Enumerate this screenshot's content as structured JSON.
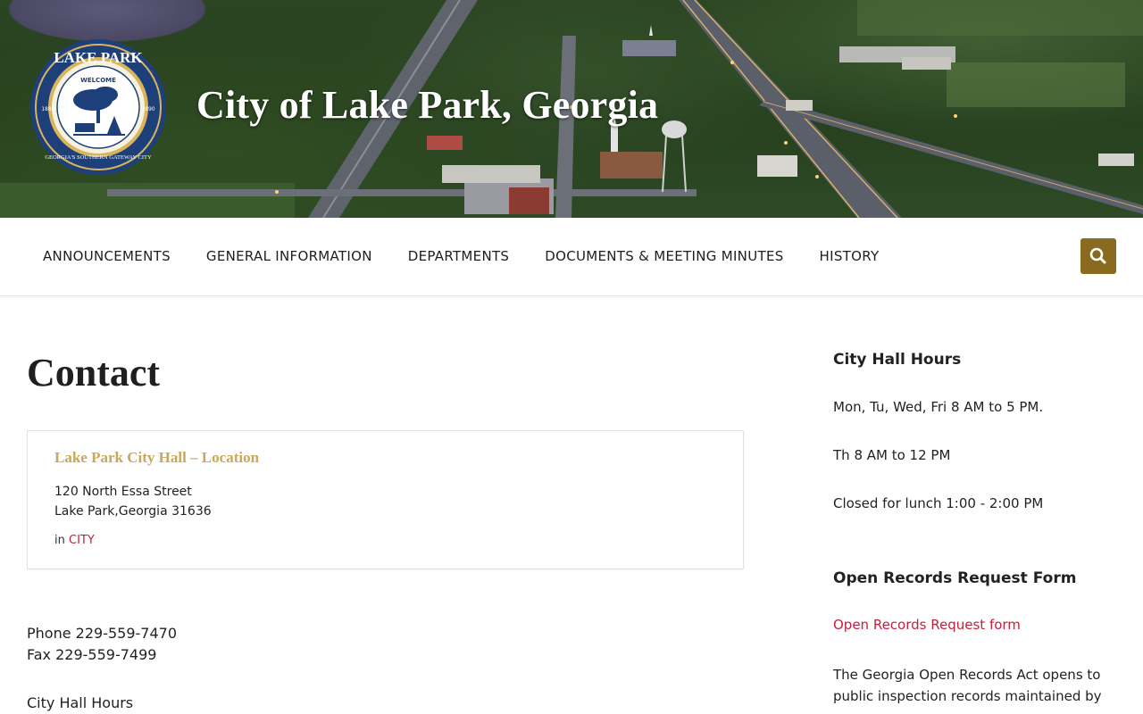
{
  "site": {
    "title": "City of Lake Park, Georgia",
    "logo": {
      "top_text": "LAKE PARK",
      "welcome": "WELCOME",
      "bottom_text": "GEORGIA'S SOUTHERN GATEWAY CITY",
      "year_left": "1889",
      "year_right": "1890"
    }
  },
  "nav": {
    "items": [
      {
        "label": "ANNOUNCEMENTS"
      },
      {
        "label": "GENERAL INFORMATION"
      },
      {
        "label": "DEPARTMENTS"
      },
      {
        "label": "DOCUMENTS & MEETING MINUTES"
      },
      {
        "label": "HISTORY"
      }
    ],
    "search_icon": "search-icon"
  },
  "main": {
    "title": "Contact",
    "card": {
      "title": "Lake Park City Hall – Location",
      "address_line1": "120 North Essa Street",
      "address_line2": "Lake Park,Georgia 31636",
      "in_label": "in",
      "category": "CITY"
    },
    "phone": "Phone 229-559-7470",
    "fax": "Fax 229-559-7499",
    "hours_label": "City Hall Hours"
  },
  "sidebar": {
    "hours_heading": "City Hall Hours",
    "hours_line1": "Mon, Tu, Wed, Fri   8 AM to 5 PM.",
    "hours_line2": "Th 8 AM to 12 PM",
    "hours_line3": "Closed for lunch 1:00 - 2:00 PM",
    "records_heading": "Open Records Request Form",
    "records_link": "Open Records Request form",
    "records_text": "The Georgia Open Records Act opens to public inspection records maintained by"
  },
  "colors": {
    "accent": "#8a6a1f",
    "card_title": "#c9a85c",
    "link": "#c51f3c",
    "logo_navy": "#1d3f7a",
    "logo_gold": "#d8b45c"
  }
}
